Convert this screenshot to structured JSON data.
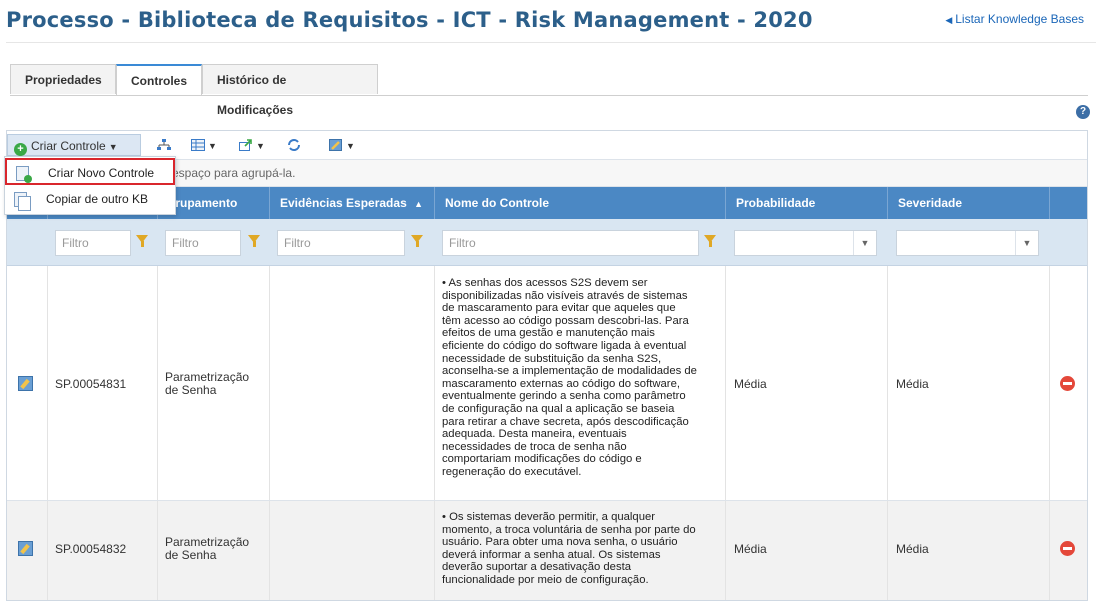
{
  "header": {
    "title": "Processo - Biblioteca de Requisitos - ICT - Risk Management - 2020",
    "back_link": "Listar Knowledge Bases"
  },
  "tabs": [
    {
      "label": "Propriedades",
      "active": false
    },
    {
      "label": "Controles",
      "active": true
    },
    {
      "label": "Histórico de Modificações",
      "active": false
    }
  ],
  "toolbar": {
    "create_label": "Criar Controle",
    "icons": [
      "hierarchy-icon",
      "columns-icon",
      "export-icon",
      "refresh-icon",
      "edit-options-icon"
    ]
  },
  "menu": {
    "items": [
      {
        "label": "Criar Novo Controle",
        "icon": "new-document-icon",
        "highlighted": true
      },
      {
        "label": "Copiar de outro KB",
        "icon": "copy-document-icon",
        "highlighted": false
      }
    ]
  },
  "group_bar": {
    "text": "espaço para agrupá-la."
  },
  "columns": [
    "",
    "",
    "grupamento",
    "Evidências Esperadas",
    "Nome do Controle",
    "Probabilidade",
    "Severidade",
    ""
  ],
  "sort_indicator": "▲",
  "filters": {
    "placeholder": "Filtro"
  },
  "rows": [
    {
      "id": "SP.00054831",
      "group": "Parametrização de Senha",
      "evidence": "",
      "name_lines": [
        "• As senhas dos acessos S2S devem ser",
        "disponibilizadas não visíveis através de sistemas",
        "de mascaramento para evitar que aqueles que",
        "têm acesso ao código possam descobri-las. Para",
        "efeitos de uma gestão e manutenção mais",
        "eficiente do código do software ligada à eventual",
        "necessidade de substituição da senha S2S,",
        "aconselha-se a implementação de modalidades de",
        "mascaramento externas ao código do software,",
        "eventualmente gerindo a senha como parâmetro",
        "de configuração na qual a aplicação se baseia",
        "para retirar a chave secreta, após descodificação",
        "adequada. Desta maneira, eventuais",
        "necessidades de troca de senha não",
        "comportariam modificações do código e",
        "regeneração do executável."
      ],
      "probability": "Média",
      "severity": "Média"
    },
    {
      "id": "SP.00054832",
      "group": "Parametrização de Senha",
      "evidence": "",
      "name_lines": [
        "• Os sistemas deverão permitir, a qualquer",
        "momento, a troca voluntária de senha por parte do",
        "usuário. Para obter uma nova senha, o usuário",
        "deverá informar a senha atual. Os sistemas",
        "deverão suportar a desativação desta",
        "funcionalidade por meio de configuração."
      ],
      "probability": "Média",
      "severity": "Média"
    }
  ],
  "colors": {
    "title": "#2c5f8a",
    "header_bg": "#4b88c4",
    "filter_bg": "#d9e6f2",
    "highlight_border": "#d9262c"
  }
}
